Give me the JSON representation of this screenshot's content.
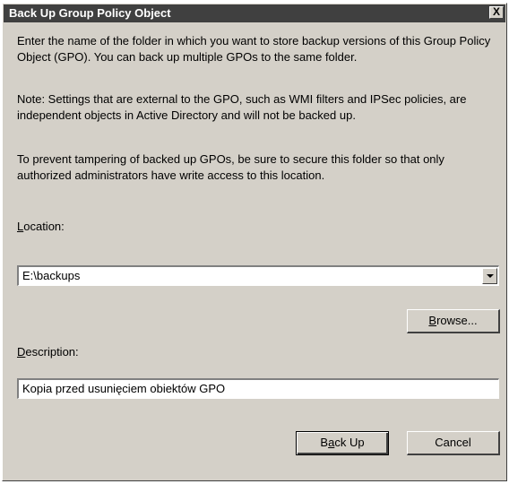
{
  "window": {
    "title": "Back Up Group Policy Object",
    "close_glyph": "X"
  },
  "body": {
    "para1": "Enter the name of the folder in which you want to store backup versions of this Group Policy Object (GPO). You can back up multiple GPOs to the same folder.",
    "para2": "Note: Settings that are external to the GPO, such as WMI filters and IPSec policies, are independent objects in Active Directory and will not be backed up.",
    "para3": "To prevent tampering of backed up GPOs, be sure to secure this folder so that only authorized administrators have write access to this location."
  },
  "location": {
    "label_mnemonic": "L",
    "label_rest": "ocation:",
    "value": "E:\\backups"
  },
  "description": {
    "label_mnemonic": "D",
    "label_rest": "escription:",
    "value": "Kopia przed usunięciem obiektów GPO"
  },
  "buttons": {
    "browse_mnemonic": "B",
    "browse_rest": "rowse...",
    "backup_pre": "B",
    "backup_mnemonic": "a",
    "backup_rest": "ck Up",
    "cancel": "Cancel"
  },
  "colors": {
    "dialog_face": "#d4d0c8",
    "titlebar": "#404040",
    "title_text": "#ffffff"
  }
}
